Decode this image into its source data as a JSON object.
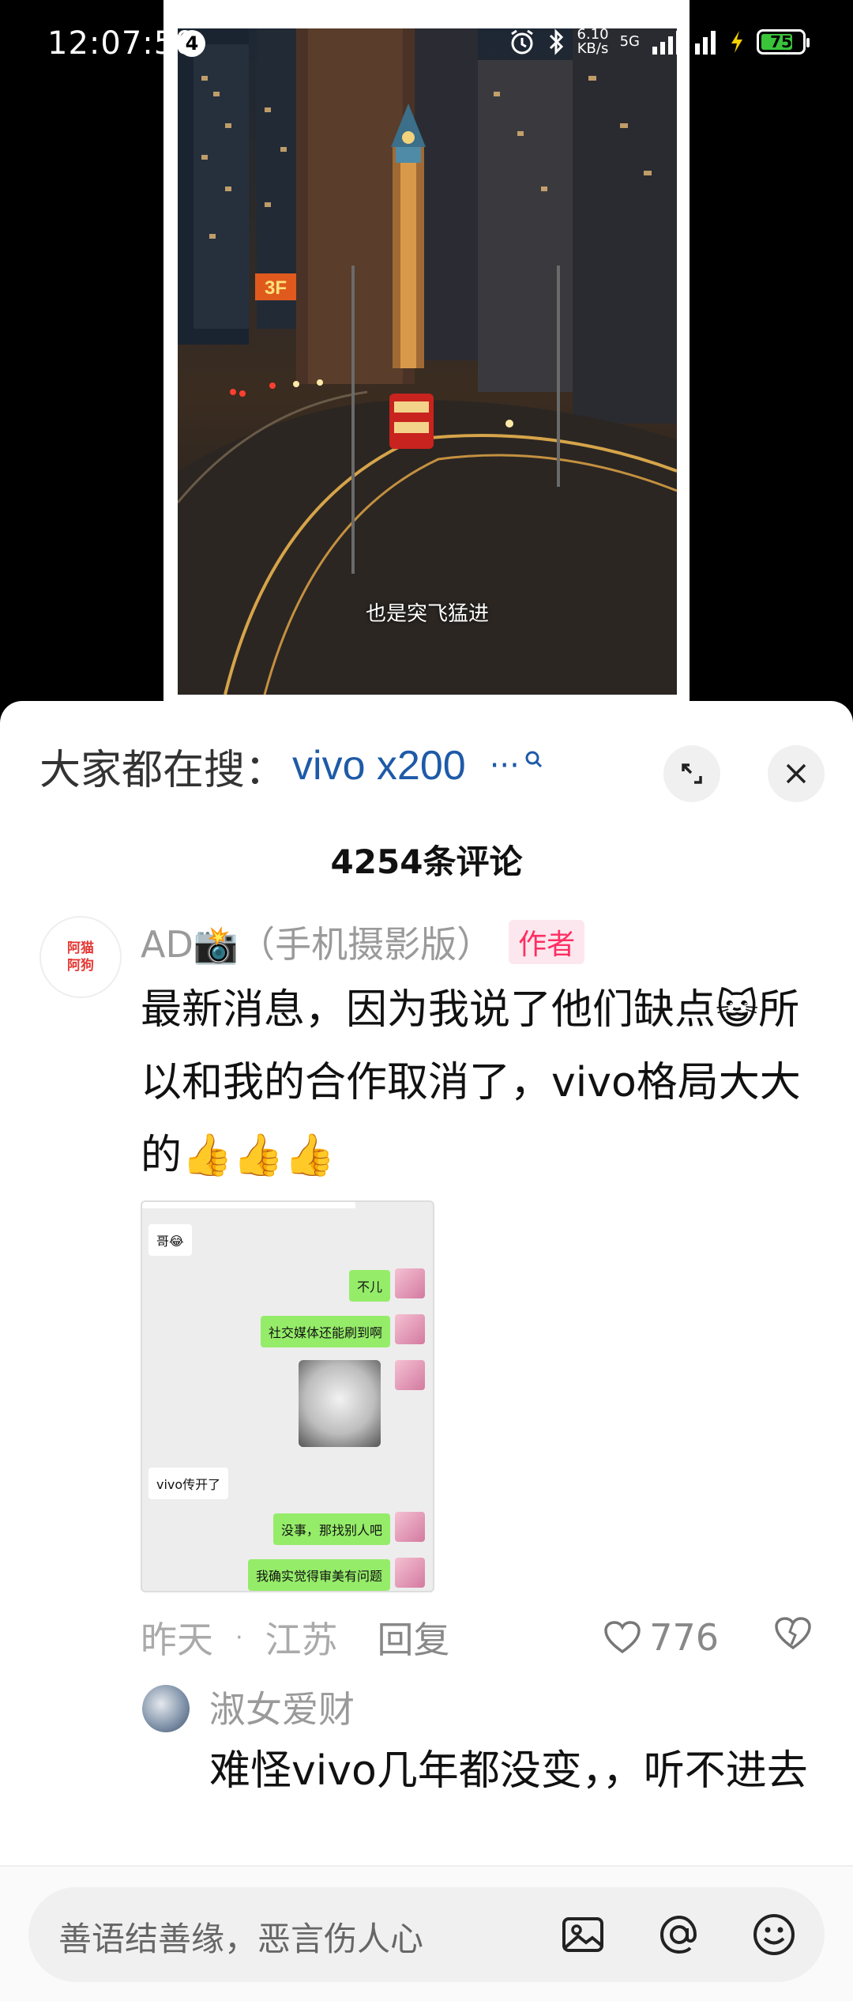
{
  "status_bar": {
    "time": "12:07:50",
    "notification_count": "4",
    "net_speed": "6.10",
    "net_unit": "KB/s",
    "network": "5G",
    "battery": "75"
  },
  "video": {
    "subtitle": "也是突飞猛进",
    "sign": "3F"
  },
  "sheet": {
    "search_label": "大家都在搜：",
    "search_term": "vivo  x200",
    "search_more": "···",
    "comment_count": "4254条评论"
  },
  "comment": {
    "avatar_line1": "阿猫",
    "avatar_line2": "阿狗",
    "author": "AD📸（手机摄影版）",
    "author_badge": "作者",
    "text": "最新消息，因为我说了他们缺点😺所以和我的合作取消了，vivo格局大大的👍👍👍",
    "time": "昨天",
    "location": "江苏",
    "reply_label": "回复",
    "likes": "776"
  },
  "screenshot_chat": [
    {
      "side": "l",
      "text": "哥😂"
    },
    {
      "side": "r",
      "text": "不儿"
    },
    {
      "side": "r",
      "text": "社交媒体还能刷到啊"
    },
    {
      "side": "l",
      "text": "vivo传开了"
    },
    {
      "side": "r",
      "text": "没事，那找别人吧"
    },
    {
      "side": "r",
      "text": "我确实觉得审美有问题"
    }
  ],
  "reply": {
    "author": "淑女爱财",
    "text": "难怪vivo几年都没变，，听不进去"
  },
  "input": {
    "placeholder": "善语结善缘，恶言伤人心"
  }
}
